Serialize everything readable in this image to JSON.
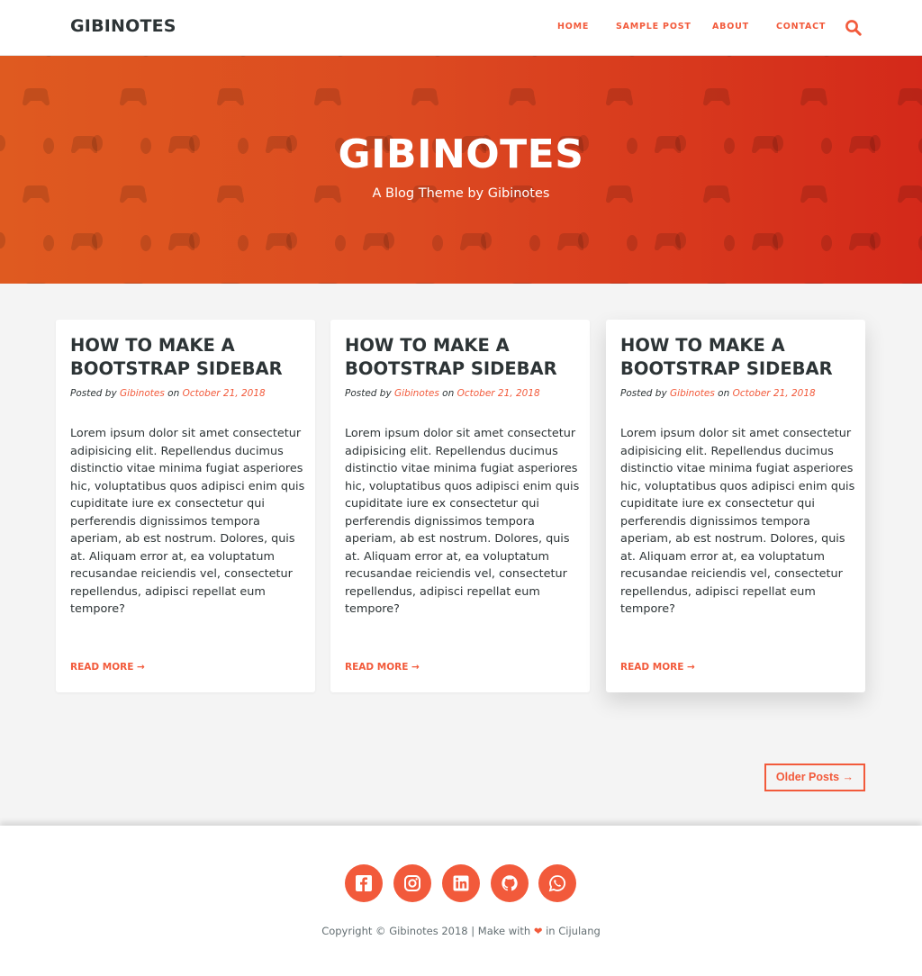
{
  "brand": "GIBINOTES",
  "nav": {
    "items": [
      {
        "label": "HOME"
      },
      {
        "label": "SAMPLE POST"
      },
      {
        "label": "ABOUT"
      },
      {
        "label": "CONTACT"
      }
    ],
    "search_icon": "search-icon"
  },
  "hero": {
    "title": "GIBINOTES",
    "subtitle": "A Blog Theme by Gibinotes",
    "pattern_icon": "gamepad-icon"
  },
  "posts": [
    {
      "title": "HOW TO MAKE A BOOTSTRAP SIDEBAR",
      "posted_by": "Posted by",
      "author": "Gibinotes",
      "on": "on",
      "date": "October 21, 2018",
      "excerpt": "Lorem ipsum dolor sit amet consectetur adipisicing elit. Repellendus ducimus distinctio vitae minima fugiat asperiores hic, voluptatibus quos adipisci enim quis cupiditate iure ex consectetur qui perferendis dignissimos tempora aperiam, ab est nostrum. Dolores, quis at. Aliquam error at, ea voluptatum recusandae reiciendis vel, consectetur repellendus, adipisci repellat eum tempore?",
      "read_more": "READ MORE →"
    },
    {
      "title": "HOW TO MAKE A BOOTSTRAP SIDEBAR",
      "posted_by": "Posted by",
      "author": "Gibinotes",
      "on": "on",
      "date": "October 21, 2018",
      "excerpt": "Lorem ipsum dolor sit amet consectetur adipisicing elit. Repellendus ducimus distinctio vitae minima fugiat asperiores hic, voluptatibus quos adipisci enim quis cupiditate iure ex consectetur qui perferendis dignissimos tempora aperiam, ab est nostrum. Dolores, quis at. Aliquam error at, ea voluptatum recusandae reiciendis vel, consectetur repellendus, adipisci repellat eum tempore?",
      "read_more": "READ MORE →"
    },
    {
      "title": "HOW TO MAKE A BOOTSTRAP SIDEBAR",
      "posted_by": "Posted by",
      "author": "Gibinotes",
      "on": "on",
      "date": "October 21, 2018",
      "excerpt": "Lorem ipsum dolor sit amet consectetur adipisicing elit. Repellendus ducimus distinctio vitae minima fugiat asperiores hic, voluptatibus quos adipisci enim quis cupiditate iure ex consectetur qui perferendis dignissimos tempora aperiam, ab est nostrum. Dolores, quis at. Aliquam error at, ea voluptatum recusandae reiciendis vel, consectetur repellendus, adipisci repellat eum tempore?",
      "read_more": "READ MORE →"
    }
  ],
  "pagination": {
    "older_label": "Older Posts →"
  },
  "footer": {
    "social": [
      {
        "icon": "facebook-icon"
      },
      {
        "icon": "instagram-icon"
      },
      {
        "icon": "linkedin-icon"
      },
      {
        "icon": "github-icon"
      },
      {
        "icon": "whatsapp-icon"
      }
    ],
    "copyright_prefix": "Copyright © Gibinotes 2018 | Make with",
    "heart": "❤",
    "copyright_suffix": "in Cijulang"
  },
  "colors": {
    "accent": "#f25a3b",
    "hero_start": "#df5a20",
    "hero_end": "#d4291a",
    "text_dark": "#2d3436",
    "page_bg": "#f4f4f4"
  }
}
